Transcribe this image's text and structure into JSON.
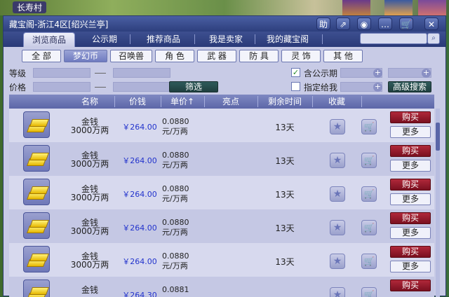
{
  "game": {
    "location": "长寿村"
  },
  "window": {
    "title": "藏宝阁-浙江4区[绍兴兰亭]",
    "title_buttons": [
      {
        "name": "help-button",
        "glyph": "助"
      },
      {
        "name": "share-button",
        "glyph": "⇗"
      },
      {
        "name": "record-button",
        "glyph": "◉"
      },
      {
        "name": "chat-button",
        "glyph": "…"
      },
      {
        "name": "cart-button",
        "glyph": "🛒"
      },
      {
        "name": "close-button",
        "glyph": "✕"
      }
    ]
  },
  "tabs": [
    {
      "label": "浏览商品",
      "active": true
    },
    {
      "label": "公示期",
      "active": false
    },
    {
      "label": "推荐商品",
      "active": false
    },
    {
      "label": "我是卖家",
      "active": false
    },
    {
      "label": "我的藏宝阁",
      "active": false
    }
  ],
  "search": {
    "placeholder": ""
  },
  "categories": [
    {
      "label": "全 部",
      "active": false
    },
    {
      "label": "梦幻币",
      "active": true
    },
    {
      "label": "召唤兽",
      "active": false
    },
    {
      "label": "角 色",
      "active": false
    },
    {
      "label": "武 器",
      "active": false
    },
    {
      "label": "防 具",
      "active": false
    },
    {
      "label": "灵 饰",
      "active": false
    },
    {
      "label": "其 他",
      "active": false
    }
  ],
  "filters": {
    "level_label": "等级",
    "price_label": "价格",
    "filter_button": "筛选",
    "public_period_label": "含公示期",
    "public_period_checked": true,
    "designated_label": "指定给我",
    "designated_checked": false,
    "advanced_search_button": "高级搜索"
  },
  "table": {
    "headers": [
      "名称",
      "价钱",
      "单价↑",
      "亮点",
      "剩余时间",
      "收藏"
    ],
    "rows": [
      {
        "name_line1": "金钱",
        "name_line2": "3000万两",
        "price": "￥264.00",
        "unit_line1": "0.0880",
        "unit_line2": "元/万两",
        "time": "13天",
        "buy": "购买",
        "more": "更多"
      },
      {
        "name_line1": "金钱",
        "name_line2": "3000万两",
        "price": "￥264.00",
        "unit_line1": "0.0880",
        "unit_line2": "元/万两",
        "time": "13天",
        "buy": "购买",
        "more": "更多"
      },
      {
        "name_line1": "金钱",
        "name_line2": "3000万两",
        "price": "￥264.00",
        "unit_line1": "0.0880",
        "unit_line2": "元/万两",
        "time": "13天",
        "buy": "购买",
        "more": "更多"
      },
      {
        "name_line1": "金钱",
        "name_line2": "3000万两",
        "price": "￥264.00",
        "unit_line1": "0.0880",
        "unit_line2": "元/万两",
        "time": "13天",
        "buy": "购买",
        "more": "更多"
      },
      {
        "name_line1": "金钱",
        "name_line2": "3000万两",
        "price": "￥264.00",
        "unit_line1": "0.0880",
        "unit_line2": "元/万两",
        "time": "13天",
        "buy": "购买",
        "more": "更多"
      },
      {
        "name_line1": "金钱",
        "name_line2": "",
        "price": "￥264.30",
        "unit_line1": "0.0881",
        "unit_line2": "",
        "time": "",
        "buy": "购买",
        "more": ""
      }
    ]
  },
  "icons": {
    "favorite": "star-icon",
    "cart": "cart-icon",
    "item": "gold-ingot-icon"
  },
  "colors": {
    "title_bar": "#2d3f7d",
    "buy_button": "#9a1a2c",
    "price_text": "#2233cc",
    "panel_bg": "#c8cbe6"
  }
}
